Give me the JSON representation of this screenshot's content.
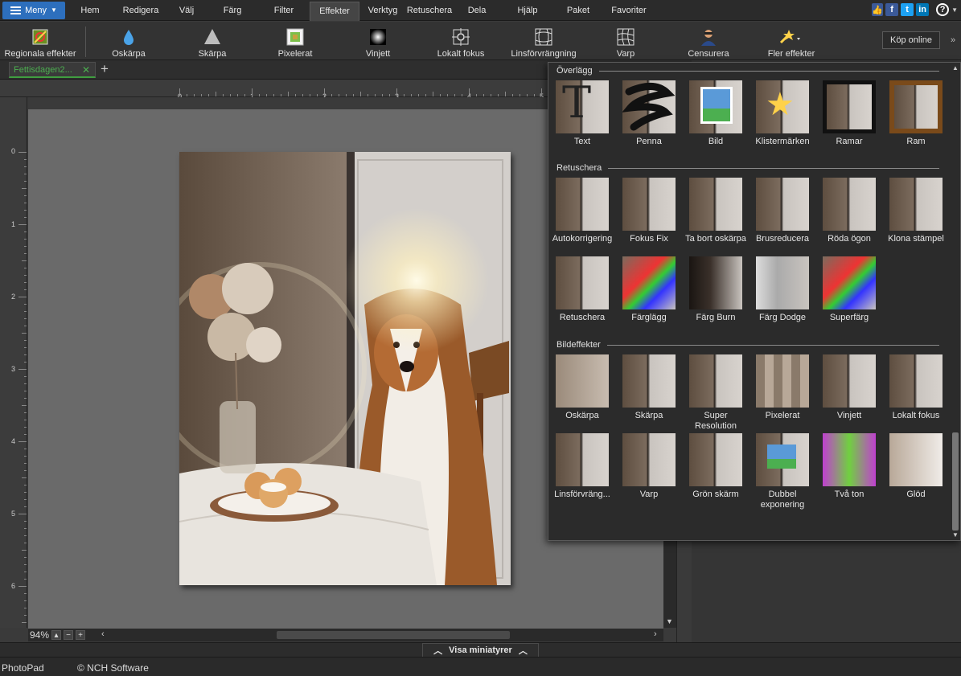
{
  "menubar": {
    "menu_label": "Meny",
    "tabs": [
      "Hem",
      "Redigera",
      "Välj",
      "Färg",
      "Filter",
      "Effekter",
      "Verktyg",
      "Retuschera",
      "Dela",
      "Hjälp",
      "Paket",
      "Favoriter"
    ],
    "active_tab": "Effekter"
  },
  "toolbar": {
    "tools": [
      "Regionala effekter",
      "Oskärpa",
      "Skärpa",
      "Pixelerat",
      "Vinjett",
      "Lokalt fokus",
      "Linsförvrängning",
      "Varp",
      "Censurera",
      "Fler effekter"
    ],
    "kop_online": "Köp online",
    "more": "»"
  },
  "document": {
    "tab_name": "Fettisdagen2...",
    "close": "✕",
    "new_tab": "+"
  },
  "rulers": {
    "h_labels": [
      "0",
      "1",
      "2",
      "3",
      "4",
      "5"
    ],
    "v_labels": [
      "0",
      "1",
      "2",
      "3",
      "4",
      "5",
      "6"
    ]
  },
  "zoom": {
    "value": "94%"
  },
  "bottom": {
    "visa_miniatyrer": "Visa miniatyrer",
    "app_name": "PhotoPad",
    "copyright": "© NCH Software"
  },
  "popup": {
    "sections": [
      {
        "title": "Överlägg",
        "items": [
          "Text",
          "Penna",
          "Bild",
          "Klistermärken",
          "Ramar",
          "Ram"
        ]
      },
      {
        "title": "Retuschera",
        "items": [
          "Autokorrigering",
          "Fokus Fix",
          "Ta bort oskärpa",
          "Brusreducera",
          "Röda ögon",
          "Klona stämpel",
          "Retuschera",
          "Färglägg",
          "Färg Burn",
          "Färg Dodge",
          "Superfärg"
        ]
      },
      {
        "title": "Bildeffekter",
        "items": [
          "Oskärpa",
          "Skärpa",
          "Super Resolution",
          "Pixelerat",
          "Vinjett",
          "Lokalt fokus",
          "Linsförvräng...",
          "Varp",
          "Grön skärm",
          "Dubbel exponering",
          "Två ton",
          "Glöd"
        ]
      }
    ]
  },
  "colors": {
    "accent": "#2d6fbd",
    "tab_green": "#4caf50",
    "background": "#3a3a3a"
  }
}
